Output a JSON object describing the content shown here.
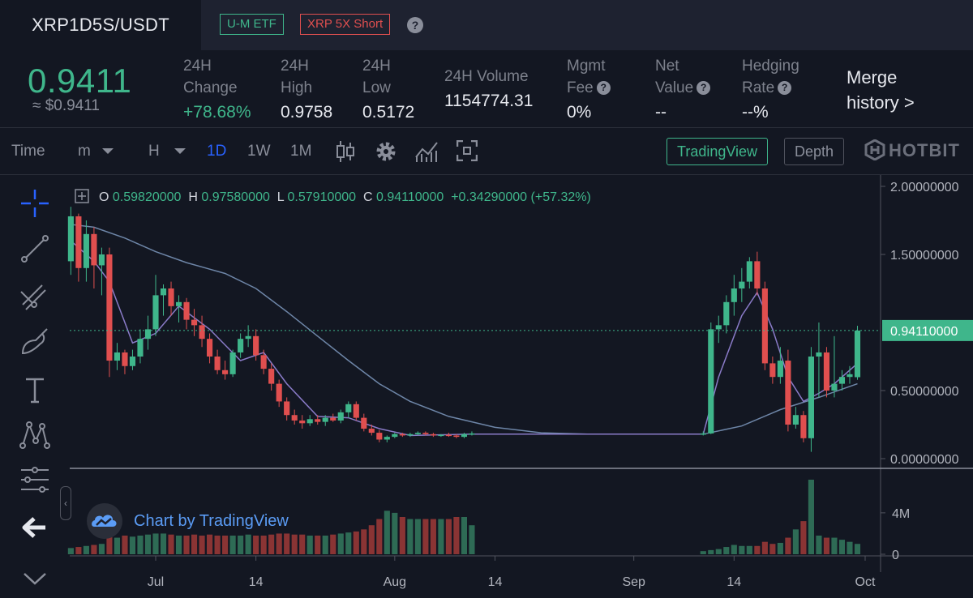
{
  "header": {
    "pair": "XRP1D5S/USDT",
    "badge_etf": "U-M ETF",
    "badge_short": "XRP 5X Short",
    "help": "?"
  },
  "stats": {
    "price": "0.9411",
    "price_usd": "≈ $0.9411",
    "change_label_1": "24H",
    "change_label_2": "Change",
    "change_value": "+78.68%",
    "high_label_1": "24H",
    "high_label_2": "High",
    "high_value": "0.9758",
    "low_label_1": "24H",
    "low_label_2": "Low",
    "low_value": "0.5172",
    "volume_label": "24H Volume",
    "volume_value": "1154774.31",
    "fee_label_1": "Mgmt",
    "fee_label_2": "Fee",
    "fee_value": "0%",
    "net_label_1": "Net",
    "net_label_2": "Value",
    "net_value": "--",
    "hedge_label_1": "Hedging",
    "hedge_label_2": "Rate",
    "hedge_value": "--%",
    "merge_1": "Merge",
    "merge_2": "history >"
  },
  "toolbar": {
    "time": "Time",
    "minute": "m",
    "hour": "H",
    "day": "1D",
    "week": "1W",
    "month": "1M",
    "tradingview": "TradingView",
    "depth": "Depth",
    "logo": "HOTBIT"
  },
  "ohlc": {
    "o_label": "O",
    "o": "0.59820000",
    "h_label": "H",
    "h": "0.97580000",
    "l_label": "L",
    "l": "0.57910000",
    "c_label": "C",
    "c": "0.94110000",
    "change": "+0.34290000",
    "change_pct": "(+57.32%)"
  },
  "watermark": "Chart by TradingView",
  "colors": {
    "up": "#3fb68b",
    "down": "#e04f4f",
    "ma_long": "#6e86a8",
    "ma_short": "#8a7bc8",
    "bg": "#131722"
  },
  "chart_data": {
    "type": "candlestick",
    "title": "",
    "xlabel": "",
    "ylabel": "",
    "ylim": [
      0,
      2
    ],
    "y_ticks": [
      "2.00000000",
      "1.50000000",
      "0.50000000",
      "0.00000000"
    ],
    "vol_ticks": [
      "4M",
      "0"
    ],
    "x_ticks": [
      {
        "date": "2020-07-01",
        "label": "Jul"
      },
      {
        "date": "2020-07-14",
        "label": "14"
      },
      {
        "date": "2020-08-01",
        "label": "Aug"
      },
      {
        "date": "2020-08-14",
        "label": "14"
      },
      {
        "date": "2020-09-01",
        "label": "Sep"
      },
      {
        "date": "2020-09-14",
        "label": "14"
      },
      {
        "date": "2020-10-01",
        "label": "Oct"
      }
    ],
    "last_price": "0.94110000",
    "last_price_value": 0.9411,
    "candles": [
      {
        "date": "2020-06-20",
        "o": 1.45,
        "h": 1.85,
        "l": 1.35,
        "c": 1.78,
        "v": 0.3
      },
      {
        "date": "2020-06-21",
        "o": 1.78,
        "h": 1.8,
        "l": 1.3,
        "c": 1.4,
        "v": 0.35
      },
      {
        "date": "2020-06-22",
        "o": 1.4,
        "h": 1.75,
        "l": 1.3,
        "c": 1.65,
        "v": 0.4
      },
      {
        "date": "2020-06-23",
        "o": 1.65,
        "h": 1.7,
        "l": 1.25,
        "c": 1.42,
        "v": 0.45
      },
      {
        "date": "2020-06-24",
        "o": 1.42,
        "h": 1.55,
        "l": 1.2,
        "c": 1.5,
        "v": 0.5
      },
      {
        "date": "2020-06-25",
        "o": 1.5,
        "h": 1.55,
        "l": 0.6,
        "c": 0.72,
        "v": 0.9
      },
      {
        "date": "2020-06-26",
        "o": 0.72,
        "h": 0.85,
        "l": 0.65,
        "c": 0.78,
        "v": 0.8
      },
      {
        "date": "2020-06-27",
        "o": 0.78,
        "h": 0.8,
        "l": 0.62,
        "c": 0.68,
        "v": 0.9
      },
      {
        "date": "2020-06-28",
        "o": 0.68,
        "h": 0.8,
        "l": 0.65,
        "c": 0.75,
        "v": 0.85
      },
      {
        "date": "2020-06-29",
        "o": 0.75,
        "h": 0.95,
        "l": 0.7,
        "c": 0.88,
        "v": 0.9
      },
      {
        "date": "2020-06-30",
        "o": 0.88,
        "h": 1.05,
        "l": 0.8,
        "c": 0.95,
        "v": 0.95
      },
      {
        "date": "2020-07-01",
        "o": 0.95,
        "h": 1.35,
        "l": 0.9,
        "c": 1.2,
        "v": 1.0
      },
      {
        "date": "2020-07-02",
        "o": 1.2,
        "h": 1.28,
        "l": 1.05,
        "c": 1.25,
        "v": 1.0
      },
      {
        "date": "2020-07-03",
        "o": 1.25,
        "h": 1.3,
        "l": 1.05,
        "c": 1.12,
        "v": 0.95
      },
      {
        "date": "2020-07-04",
        "o": 1.12,
        "h": 1.2,
        "l": 1.0,
        "c": 1.15,
        "v": 0.9
      },
      {
        "date": "2020-07-05",
        "o": 1.15,
        "h": 1.18,
        "l": 0.95,
        "c": 1.02,
        "v": 0.9
      },
      {
        "date": "2020-07-06",
        "o": 1.02,
        "h": 1.1,
        "l": 0.9,
        "c": 0.98,
        "v": 0.95
      },
      {
        "date": "2020-07-07",
        "o": 0.98,
        "h": 1.05,
        "l": 0.82,
        "c": 0.88,
        "v": 0.9
      },
      {
        "date": "2020-07-08",
        "o": 0.88,
        "h": 0.92,
        "l": 0.7,
        "c": 0.75,
        "v": 0.95
      },
      {
        "date": "2020-07-09",
        "o": 0.75,
        "h": 0.8,
        "l": 0.62,
        "c": 0.65,
        "v": 0.9
      },
      {
        "date": "2020-07-10",
        "o": 0.65,
        "h": 0.72,
        "l": 0.58,
        "c": 0.62,
        "v": 0.9
      },
      {
        "date": "2020-07-11",
        "o": 0.62,
        "h": 0.8,
        "l": 0.6,
        "c": 0.78,
        "v": 0.9
      },
      {
        "date": "2020-07-12",
        "o": 0.78,
        "h": 0.92,
        "l": 0.74,
        "c": 0.88,
        "v": 0.9
      },
      {
        "date": "2020-07-13",
        "o": 0.88,
        "h": 0.98,
        "l": 0.82,
        "c": 0.9,
        "v": 0.95
      },
      {
        "date": "2020-07-14",
        "o": 0.9,
        "h": 0.95,
        "l": 0.72,
        "c": 0.76,
        "v": 0.9
      },
      {
        "date": "2020-07-15",
        "o": 0.76,
        "h": 0.8,
        "l": 0.62,
        "c": 0.66,
        "v": 0.9
      },
      {
        "date": "2020-07-16",
        "o": 0.66,
        "h": 0.7,
        "l": 0.5,
        "c": 0.55,
        "v": 0.95
      },
      {
        "date": "2020-07-17",
        "o": 0.55,
        "h": 0.58,
        "l": 0.38,
        "c": 0.42,
        "v": 1.0
      },
      {
        "date": "2020-07-18",
        "o": 0.42,
        "h": 0.45,
        "l": 0.28,
        "c": 0.32,
        "v": 1.0
      },
      {
        "date": "2020-07-19",
        "o": 0.32,
        "h": 0.36,
        "l": 0.25,
        "c": 0.28,
        "v": 0.95
      },
      {
        "date": "2020-07-20",
        "o": 0.28,
        "h": 0.32,
        "l": 0.22,
        "c": 0.26,
        "v": 0.95
      },
      {
        "date": "2020-07-21",
        "o": 0.26,
        "h": 0.32,
        "l": 0.24,
        "c": 0.29,
        "v": 0.9
      },
      {
        "date": "2020-07-22",
        "o": 0.29,
        "h": 0.32,
        "l": 0.25,
        "c": 0.27,
        "v": 0.9
      },
      {
        "date": "2020-07-23",
        "o": 0.27,
        "h": 0.32,
        "l": 0.24,
        "c": 0.3,
        "v": 0.9
      },
      {
        "date": "2020-07-24",
        "o": 0.3,
        "h": 0.33,
        "l": 0.27,
        "c": 0.28,
        "v": 0.95
      },
      {
        "date": "2020-07-25",
        "o": 0.28,
        "h": 0.36,
        "l": 0.26,
        "c": 0.34,
        "v": 1.0
      },
      {
        "date": "2020-07-26",
        "o": 0.34,
        "h": 0.42,
        "l": 0.3,
        "c": 0.4,
        "v": 1.05
      },
      {
        "date": "2020-07-27",
        "o": 0.4,
        "h": 0.42,
        "l": 0.28,
        "c": 0.3,
        "v": 1.1
      },
      {
        "date": "2020-07-28",
        "o": 0.3,
        "h": 0.33,
        "l": 0.2,
        "c": 0.22,
        "v": 1.2
      },
      {
        "date": "2020-07-29",
        "o": 0.22,
        "h": 0.25,
        "l": 0.17,
        "c": 0.19,
        "v": 1.4
      },
      {
        "date": "2020-07-30",
        "o": 0.19,
        "h": 0.21,
        "l": 0.12,
        "c": 0.14,
        "v": 1.7
      },
      {
        "date": "2020-07-31",
        "o": 0.14,
        "h": 0.17,
        "l": 0.12,
        "c": 0.16,
        "v": 2.1
      },
      {
        "date": "2020-08-01",
        "o": 0.16,
        "h": 0.19,
        "l": 0.15,
        "c": 0.18,
        "v": 2.0
      },
      {
        "date": "2020-08-02",
        "o": 0.18,
        "h": 0.19,
        "l": 0.16,
        "c": 0.17,
        "v": 1.8
      },
      {
        "date": "2020-08-03",
        "o": 0.17,
        "h": 0.19,
        "l": 0.16,
        "c": 0.18,
        "v": 1.7
      },
      {
        "date": "2020-08-04",
        "o": 0.18,
        "h": 0.2,
        "l": 0.17,
        "c": 0.19,
        "v": 1.7
      },
      {
        "date": "2020-08-05",
        "o": 0.19,
        "h": 0.2,
        "l": 0.17,
        "c": 0.18,
        "v": 1.7
      },
      {
        "date": "2020-08-06",
        "o": 0.18,
        "h": 0.19,
        "l": 0.16,
        "c": 0.17,
        "v": 1.7
      },
      {
        "date": "2020-08-07",
        "o": 0.17,
        "h": 0.18,
        "l": 0.16,
        "c": 0.175,
        "v": 1.7
      },
      {
        "date": "2020-08-08",
        "o": 0.175,
        "h": 0.19,
        "l": 0.16,
        "c": 0.17,
        "v": 1.7
      },
      {
        "date": "2020-08-09",
        "o": 0.17,
        "h": 0.18,
        "l": 0.15,
        "c": 0.16,
        "v": 1.8
      },
      {
        "date": "2020-08-10",
        "o": 0.16,
        "h": 0.19,
        "l": 0.15,
        "c": 0.18,
        "v": 1.8
      },
      {
        "date": "2020-08-11",
        "o": 0.18,
        "h": 0.2,
        "l": 0.17,
        "c": 0.185,
        "v": 1.4
      },
      {
        "date": "2020-09-10",
        "o": 0.18,
        "h": 0.2,
        "l": 0.17,
        "c": 0.185,
        "v": 0.15
      },
      {
        "date": "2020-09-11",
        "o": 0.185,
        "h": 1.0,
        "l": 0.18,
        "c": 0.95,
        "v": 0.2
      },
      {
        "date": "2020-09-12",
        "o": 0.95,
        "h": 1.05,
        "l": 0.85,
        "c": 0.98,
        "v": 0.25
      },
      {
        "date": "2020-09-13",
        "o": 0.98,
        "h": 1.2,
        "l": 0.92,
        "c": 1.15,
        "v": 0.35
      },
      {
        "date": "2020-09-14",
        "o": 1.15,
        "h": 1.35,
        "l": 1.05,
        "c": 1.25,
        "v": 0.45
      },
      {
        "date": "2020-09-15",
        "o": 1.25,
        "h": 1.4,
        "l": 1.15,
        "c": 1.3,
        "v": 0.4
      },
      {
        "date": "2020-09-16",
        "o": 1.3,
        "h": 1.48,
        "l": 1.25,
        "c": 1.45,
        "v": 0.4
      },
      {
        "date": "2020-09-17",
        "o": 1.45,
        "h": 1.52,
        "l": 1.2,
        "c": 1.25,
        "v": 0.4
      },
      {
        "date": "2020-09-18",
        "o": 1.25,
        "h": 1.3,
        "l": 0.65,
        "c": 0.7,
        "v": 0.6
      },
      {
        "date": "2020-09-19",
        "o": 0.7,
        "h": 0.75,
        "l": 0.55,
        "c": 0.6,
        "v": 0.5
      },
      {
        "date": "2020-09-20",
        "o": 0.6,
        "h": 0.82,
        "l": 0.55,
        "c": 0.72,
        "v": 0.55
      },
      {
        "date": "2020-09-21",
        "o": 0.72,
        "h": 0.8,
        "l": 0.2,
        "c": 0.25,
        "v": 0.8
      },
      {
        "date": "2020-09-22",
        "o": 0.25,
        "h": 0.38,
        "l": 0.22,
        "c": 0.32,
        "v": 1.2
      },
      {
        "date": "2020-09-23",
        "o": 0.32,
        "h": 0.35,
        "l": 0.12,
        "c": 0.15,
        "v": 1.6
      },
      {
        "date": "2020-09-24",
        "o": 0.15,
        "h": 0.82,
        "l": 0.05,
        "c": 0.75,
        "v": 3.6
      },
      {
        "date": "2020-09-25",
        "o": 0.75,
        "h": 1.0,
        "l": 0.45,
        "c": 0.78,
        "v": 0.9
      },
      {
        "date": "2020-09-26",
        "o": 0.78,
        "h": 0.82,
        "l": 0.45,
        "c": 0.5,
        "v": 0.8
      },
      {
        "date": "2020-09-27",
        "o": 0.5,
        "h": 0.9,
        "l": 0.45,
        "c": 0.55,
        "v": 0.8
      },
      {
        "date": "2020-09-28",
        "o": 0.55,
        "h": 0.65,
        "l": 0.5,
        "c": 0.6,
        "v": 0.7
      },
      {
        "date": "2020-09-29",
        "o": 0.6,
        "h": 0.68,
        "l": 0.55,
        "c": 0.62,
        "v": 0.6
      },
      {
        "date": "2020-09-30",
        "o": 0.5982,
        "h": 0.9758,
        "l": 0.5791,
        "c": 0.9411,
        "v": 0.5
      }
    ],
    "ma_long": [
      {
        "date": "2020-06-20",
        "v": 1.72
      },
      {
        "date": "2020-06-23",
        "v": 1.7
      },
      {
        "date": "2020-06-27",
        "v": 1.62
      },
      {
        "date": "2020-07-01",
        "v": 1.52
      },
      {
        "date": "2020-07-05",
        "v": 1.44
      },
      {
        "date": "2020-07-10",
        "v": 1.36
      },
      {
        "date": "2020-07-14",
        "v": 1.25
      },
      {
        "date": "2020-07-18",
        "v": 1.08
      },
      {
        "date": "2020-07-22",
        "v": 0.9
      },
      {
        "date": "2020-07-26",
        "v": 0.72
      },
      {
        "date": "2020-07-30",
        "v": 0.55
      },
      {
        "date": "2020-08-03",
        "v": 0.42
      },
      {
        "date": "2020-08-08",
        "v": 0.31
      },
      {
        "date": "2020-08-14",
        "v": 0.23
      },
      {
        "date": "2020-08-20",
        "v": 0.19
      },
      {
        "date": "2020-08-26",
        "v": 0.18
      },
      {
        "date": "2020-09-10",
        "v": 0.18
      },
      {
        "date": "2020-09-15",
        "v": 0.24
      },
      {
        "date": "2020-09-20",
        "v": 0.36
      },
      {
        "date": "2020-09-25",
        "v": 0.45
      },
      {
        "date": "2020-09-30",
        "v": 0.55
      }
    ],
    "ma_short": [
      {
        "date": "2020-06-20",
        "v": 1.6
      },
      {
        "date": "2020-06-23",
        "v": 1.45
      },
      {
        "date": "2020-06-25",
        "v": 1.3
      },
      {
        "date": "2020-06-28",
        "v": 0.85
      },
      {
        "date": "2020-07-01",
        "v": 0.92
      },
      {
        "date": "2020-07-04",
        "v": 1.12
      },
      {
        "date": "2020-07-08",
        "v": 0.95
      },
      {
        "date": "2020-07-12",
        "v": 0.72
      },
      {
        "date": "2020-07-15",
        "v": 0.78
      },
      {
        "date": "2020-07-18",
        "v": 0.55
      },
      {
        "date": "2020-07-22",
        "v": 0.31
      },
      {
        "date": "2020-07-26",
        "v": 0.3
      },
      {
        "date": "2020-07-30",
        "v": 0.22
      },
      {
        "date": "2020-08-03",
        "v": 0.17
      },
      {
        "date": "2020-08-11",
        "v": 0.18
      },
      {
        "date": "2020-09-10",
        "v": 0.18
      },
      {
        "date": "2020-09-12",
        "v": 0.6
      },
      {
        "date": "2020-09-15",
        "v": 1.05
      },
      {
        "date": "2020-09-17",
        "v": 1.22
      },
      {
        "date": "2020-09-19",
        "v": 0.95
      },
      {
        "date": "2020-09-21",
        "v": 0.6
      },
      {
        "date": "2020-09-23",
        "v": 0.42
      },
      {
        "date": "2020-09-25",
        "v": 0.48
      },
      {
        "date": "2020-09-27",
        "v": 0.55
      },
      {
        "date": "2020-09-30",
        "v": 0.7
      }
    ]
  }
}
